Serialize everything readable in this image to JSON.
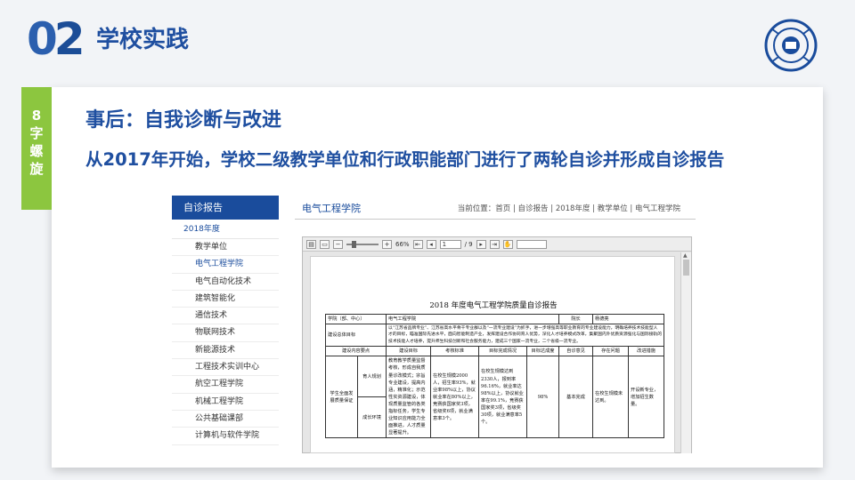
{
  "header": {
    "number_first": "0",
    "number_second": "2",
    "title": "学校实践"
  },
  "logo_icon": "university-seal",
  "side_tab": {
    "chars": [
      "8",
      "字",
      "螺",
      "旋"
    ]
  },
  "subtitle": "事后：自我诊断与改进",
  "subline": "从2017年开始，学校二级教学单位和行政职能部门进行了两轮自诊并形成自诊报告",
  "screenshot": {
    "nav_title": "自诊报告",
    "year": "2018年度",
    "nav_items": [
      "教学单位",
      "电气工程学院",
      "电气自动化技术",
      "建筑智能化",
      "通信技术",
      "物联网技术",
      "新能源技术",
      "工程技术实训中心",
      "航空工程学院",
      "机械工程学院",
      "公共基础课部",
      "计算机与软件学院"
    ],
    "active_index": 1,
    "content_title": "电气工程学院",
    "breadcrumb": "当前位置：首页 | 自诊报告 | 2018年度 | 教学单位 | 电气工程学院",
    "viewer": {
      "zoom": "66%",
      "page_current": "1",
      "page_total": "/ 9"
    },
    "document": {
      "title": "2018 年度电气工程学院质量自诊报告",
      "row1": {
        "label": "学院（部、中心）",
        "value": "电气工程学院",
        "head_label": "院长",
        "head_value": "杨德亮"
      },
      "row2": {
        "label": "建设总体目标",
        "value": "以“江苏省品牌专业”、江苏省高水平骨干专业群以及“一流专业建设”为抓手，进一步增强高等职业教育的专业建设能力，明确培养技术技能型人才的目标，瞄准国际先进水平，面向智能制造产业，发挥建设合作协同育人优势，深化人才培养模式改革，集聚国内外优质资源强化与国际接轨的技术技能人才培养，提升师生科技创新和社会服务能力，建成三个国家一流专业，二个省级一流专业。"
      },
      "columns": [
        "建设内容要点",
        "建设目标",
        "考核标准",
        "目标完成情况",
        "目标达成度",
        "自诊意见",
        "存在问题",
        "改进措施"
      ],
      "row_group": "学生全面发展质量保证",
      "sub_rows": [
        "育人规划",
        "成长环境"
      ],
      "goal": "教育教学质量监督考核，形成自我质量诊改模式；宗旨专业建设，提高内涵，精准化；示范性实资源建设，体现质量监管的各类指标任务，学生专业知识应用能力全面推进，人才质量显著提升。",
      "standard": "在校生规模2000人，招生率93%，就业率98%以上，协议就业率在80%以上，竞赛获国家奖3项，省级奖6项，就业满意率3个。",
      "completion": "在校生规模达到2330人，报到率96.16%，就业率达98%以上，协议就业率在99.1%，竞赛获国家奖3项，省级奖30项，就业满意率5个。",
      "rate": "98%",
      "opinion": "基本完成",
      "issue": "在校生规模未达到。",
      "measure": "开设新专业，增加招生数量。"
    }
  }
}
